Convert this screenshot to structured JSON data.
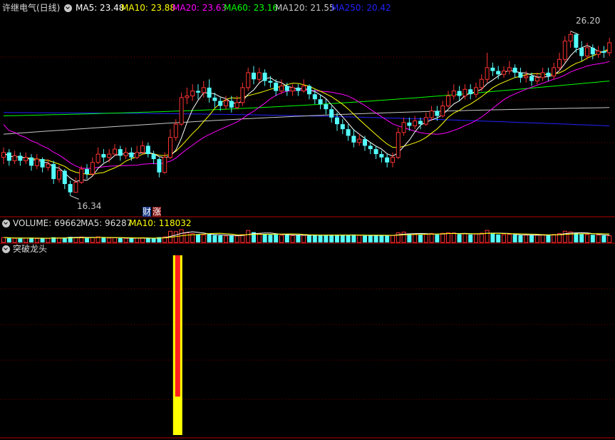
{
  "colors": {
    "up": "#ff3232",
    "down": "#54ffff",
    "divider": "#b40000",
    "grid": "#7a0000",
    "ma5": "#ffffff",
    "ma10": "#ffff00",
    "ma20": "#ff00ff",
    "ma60": "#00ff00",
    "ma120": "#c8c8c8",
    "ma250": "#2222ff",
    "signal_outer": "#ffff00",
    "signal_inner": "#ff2020"
  },
  "price_header": {
    "title": "许继电气(日线)",
    "ma5": "MA5: 23.48",
    "ma10": "MA10: 23.88",
    "ma20": "MA20: 23.63",
    "ma60": "MA60: 23.16",
    "ma120": "MA120: 21.55",
    "ma250": "MA250: 20.42"
  },
  "volume_header": {
    "volume": "VOLUME: 69662",
    "ma5": "MA5: 96287",
    "ma10": "MA10: 118032"
  },
  "indicator_header": {
    "title": "突破龙头"
  },
  "markers": {
    "cai": "财",
    "zhang": "涨",
    "high": "26.20",
    "low": "16.34"
  },
  "icons": {
    "menu": "chevron-down-icon"
  },
  "chart_data": [
    {
      "type": "candlestick",
      "title": "许继电气(日线)",
      "y_range": [
        15.2,
        27.3
      ],
      "high_label": 26.2,
      "low_label": 16.34,
      "candles": [
        [
          18.6,
          18.9,
          19.2,
          18.2
        ],
        [
          18.9,
          18.4,
          19.1,
          18.1
        ],
        [
          18.4,
          18.7,
          19.0,
          18.2
        ],
        [
          18.7,
          18.4,
          18.9,
          18.1
        ],
        [
          18.4,
          18.6,
          18.9,
          18.2
        ],
        [
          18.6,
          18.1,
          18.8,
          17.8
        ],
        [
          18.1,
          18.5,
          18.8,
          17.9
        ],
        [
          18.5,
          18.0,
          18.6,
          17.7
        ],
        [
          18.0,
          18.2,
          18.5,
          17.8
        ],
        [
          18.2,
          17.3,
          18.4,
          17.0
        ],
        [
          17.3,
          17.8,
          18.1,
          17.1
        ],
        [
          17.8,
          17.0,
          17.9,
          16.7
        ],
        [
          17.0,
          16.5,
          17.2,
          16.3
        ],
        [
          16.5,
          17.1,
          17.4,
          16.5
        ],
        [
          17.1,
          17.9,
          18.1,
          17.0
        ],
        [
          17.9,
          17.6,
          18.2,
          17.3
        ],
        [
          17.6,
          18.3,
          18.6,
          17.5
        ],
        [
          18.3,
          18.8,
          19.2,
          18.2
        ],
        [
          18.8,
          18.6,
          19.1,
          18.3
        ],
        [
          18.6,
          18.8,
          19.1,
          18.3
        ],
        [
          18.8,
          19.1,
          19.4,
          18.7
        ],
        [
          19.1,
          18.7,
          19.3,
          18.4
        ],
        [
          18.7,
          18.9,
          19.2,
          18.5
        ],
        [
          18.9,
          18.6,
          19.2,
          18.4
        ],
        [
          18.6,
          18.9,
          19.3,
          18.5
        ],
        [
          18.9,
          19.3,
          19.6,
          18.8
        ],
        [
          19.3,
          18.8,
          19.5,
          18.6
        ],
        [
          18.8,
          18.5,
          19.0,
          18.2
        ],
        [
          18.5,
          17.7,
          18.6,
          17.4
        ],
        [
          17.7,
          18.6,
          18.9,
          17.6
        ],
        [
          18.6,
          19.8,
          20.3,
          18.5
        ],
        [
          19.8,
          20.6,
          20.9,
          19.6
        ],
        [
          20.6,
          22.2,
          22.5,
          20.5
        ],
        [
          22.2,
          22.3,
          22.8,
          21.8
        ],
        [
          22.3,
          22.6,
          23.0,
          22.0
        ],
        [
          22.6,
          22.5,
          23.0,
          22.1
        ],
        [
          22.5,
          22.8,
          23.2,
          22.2
        ],
        [
          22.8,
          22.2,
          23.3,
          21.9
        ],
        [
          22.2,
          22.0,
          22.5,
          21.6
        ],
        [
          22.0,
          21.7,
          22.2,
          21.4
        ],
        [
          21.7,
          22.0,
          22.3,
          21.5
        ],
        [
          22.0,
          21.6,
          22.3,
          21.3
        ],
        [
          21.6,
          21.9,
          22.3,
          21.5
        ],
        [
          21.9,
          22.8,
          23.1,
          21.7
        ],
        [
          22.8,
          23.7,
          24.0,
          22.6
        ],
        [
          23.7,
          23.3,
          24.1,
          23.0
        ],
        [
          23.3,
          23.7,
          24.0,
          23.1
        ],
        [
          23.7,
          23.2,
          23.9,
          22.9
        ],
        [
          23.2,
          23.1,
          23.5,
          22.8
        ],
        [
          23.1,
          22.6,
          23.3,
          22.3
        ],
        [
          22.6,
          22.9,
          23.3,
          22.4
        ],
        [
          22.9,
          22.6,
          23.1,
          22.3
        ],
        [
          22.6,
          22.8,
          23.0,
          22.3
        ],
        [
          22.8,
          22.6,
          23.0,
          22.3
        ],
        [
          22.6,
          22.9,
          23.3,
          22.5
        ],
        [
          22.9,
          22.4,
          23.0,
          22.1
        ],
        [
          22.4,
          22.1,
          22.7,
          21.8
        ],
        [
          22.1,
          21.8,
          22.4,
          21.5
        ],
        [
          21.8,
          21.5,
          22.1,
          21.2
        ],
        [
          21.5,
          21.0,
          21.7,
          20.7
        ],
        [
          21.0,
          20.6,
          21.3,
          20.2
        ],
        [
          20.6,
          20.3,
          20.9,
          20.0
        ],
        [
          20.3,
          19.9,
          20.6,
          19.6
        ],
        [
          19.9,
          19.5,
          20.3,
          19.2
        ],
        [
          19.5,
          19.7,
          20.0,
          19.3
        ],
        [
          19.7,
          19.3,
          19.9,
          19.0
        ],
        [
          19.3,
          19.1,
          19.5,
          18.8
        ],
        [
          19.1,
          18.8,
          19.3,
          18.5
        ],
        [
          18.8,
          18.6,
          19.0,
          18.3
        ],
        [
          18.6,
          18.3,
          18.8,
          18.0
        ],
        [
          18.3,
          18.6,
          18.9,
          18.0
        ],
        [
          18.6,
          20.1,
          20.4,
          18.5
        ],
        [
          20.1,
          20.7,
          21.0,
          19.9
        ],
        [
          20.7,
          20.5,
          21.0,
          20.2
        ],
        [
          20.5,
          20.8,
          21.1,
          20.3
        ],
        [
          20.8,
          20.6,
          21.0,
          20.3
        ],
        [
          20.6,
          21.0,
          21.3,
          20.5
        ],
        [
          21.0,
          21.4,
          21.7,
          20.8
        ],
        [
          21.4,
          21.1,
          21.7,
          20.8
        ],
        [
          21.1,
          21.7,
          22.0,
          21.0
        ],
        [
          21.7,
          22.3,
          22.6,
          21.6
        ],
        [
          22.3,
          22.6,
          23.0,
          22.1
        ],
        [
          22.6,
          22.3,
          22.9,
          22.0
        ],
        [
          22.3,
          22.7,
          23.0,
          22.1
        ],
        [
          22.7,
          22.4,
          23.0,
          22.1
        ],
        [
          22.4,
          22.8,
          23.1,
          22.2
        ],
        [
          22.8,
          23.3,
          23.6,
          22.6
        ],
        [
          23.3,
          24.0,
          24.9,
          23.1
        ],
        [
          24.0,
          23.8,
          24.3,
          23.5
        ],
        [
          23.8,
          23.6,
          24.1,
          23.3
        ],
        [
          23.6,
          23.8,
          24.1,
          23.4
        ],
        [
          23.8,
          24.0,
          24.4,
          23.6
        ],
        [
          24.0,
          23.7,
          24.2,
          23.4
        ],
        [
          23.7,
          23.4,
          24.0,
          23.1
        ],
        [
          23.4,
          23.5,
          23.8,
          23.1
        ],
        [
          23.5,
          23.2,
          23.7,
          22.9
        ],
        [
          23.2,
          23.4,
          23.7,
          23.0
        ],
        [
          23.4,
          23.7,
          24.0,
          23.2
        ],
        [
          23.7,
          23.5,
          24.0,
          23.2
        ],
        [
          23.5,
          24.0,
          24.3,
          23.3
        ],
        [
          24.0,
          24.5,
          24.9,
          23.8
        ],
        [
          24.5,
          25.6,
          25.9,
          24.3
        ],
        [
          25.6,
          26.0,
          26.2,
          25.2
        ],
        [
          26.0,
          25.2,
          26.1,
          24.9
        ],
        [
          25.2,
          24.7,
          25.6,
          24.4
        ],
        [
          24.7,
          25.2,
          25.5,
          24.5
        ],
        [
          25.2,
          24.8,
          25.4,
          24.5
        ],
        [
          24.8,
          25.0,
          25.3,
          24.6
        ],
        [
          25.0,
          24.9,
          25.3,
          24.6
        ],
        [
          24.9,
          25.5,
          25.8,
          24.7
        ]
      ],
      "moving_averages": [
        {
          "name": "MA5",
          "value": 23.48
        },
        {
          "name": "MA10",
          "value": 23.88
        },
        {
          "name": "MA20",
          "value": 23.63
        },
        {
          "name": "MA60",
          "value": 23.16
        },
        {
          "name": "MA120",
          "value": 21.55
        },
        {
          "name": "MA250",
          "value": 20.42
        }
      ]
    },
    {
      "type": "bar",
      "title": "VOLUME",
      "volume": 69662,
      "ma5": 96287,
      "ma10": 118032,
      "note": "per-candle volume, same order as candles",
      "values": [
        62000,
        55000,
        52000,
        50000,
        54000,
        60000,
        48000,
        52000,
        50000,
        65000,
        58000,
        62000,
        70000,
        60000,
        68000,
        56000,
        62000,
        70000,
        58000,
        55000,
        60000,
        54000,
        52000,
        50000,
        54000,
        60000,
        52000,
        50000,
        66000,
        70000,
        140000,
        135000,
        160000,
        120000,
        110000,
        100000,
        95000,
        105000,
        92000,
        88000,
        80000,
        86000,
        82000,
        98000,
        150000,
        128000,
        112000,
        105000,
        96000,
        104000,
        90000,
        94000,
        86000,
        92000,
        88000,
        96000,
        90000,
        88000,
        92000,
        96000,
        98000,
        92000,
        90000,
        94000,
        88000,
        84000,
        86000,
        92000,
        88000,
        90000,
        86000,
        120000,
        130000,
        110000,
        104000,
        96000,
        108000,
        112000,
        98000,
        114000,
        122000,
        118000,
        104000,
        108000,
        100000,
        104000,
        116000,
        150000,
        110000,
        100000,
        98000,
        102000,
        96000,
        90000,
        92000,
        88000,
        92000,
        98000,
        94000,
        100000,
        110000,
        140000,
        132000,
        120000,
        104000,
        98000,
        96000,
        92000,
        88000,
        84000
      ]
    },
    {
      "type": "bar",
      "title": "突破龙头",
      "signals": [
        {
          "index": 31,
          "value": 1
        }
      ]
    }
  ]
}
